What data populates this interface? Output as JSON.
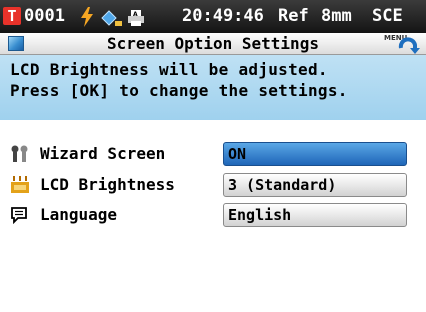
{
  "status_bar": {
    "t_label": "T",
    "sample_number": "0001",
    "time": "20:49:46",
    "ref_label": "Ref",
    "aperture": "8mm",
    "mode": "SCE",
    "icons": [
      "lightning-icon",
      "diamond-icon",
      "printer-icon"
    ]
  },
  "title_bar": {
    "title": "Screen Option Settings",
    "menu_label": "MENU"
  },
  "message": {
    "line1": "LCD Brightness will be adjusted.",
    "line2": "Press [OK] to change the settings."
  },
  "settings": [
    {
      "label": "Wizard Screen",
      "value": "ON",
      "selected": true,
      "icon": "wizard-icon"
    },
    {
      "label": "LCD Brightness",
      "value": "3 (Standard)",
      "selected": false,
      "icon": "brightness-icon"
    },
    {
      "label": "Language",
      "value": "English",
      "selected": false,
      "icon": "speech-bubble-icon"
    }
  ],
  "colors": {
    "status_bg": "#1e1e1e",
    "message_bg": "#b0d9f1",
    "selected": "#2e78c8",
    "t_badge": "#e8322a"
  }
}
